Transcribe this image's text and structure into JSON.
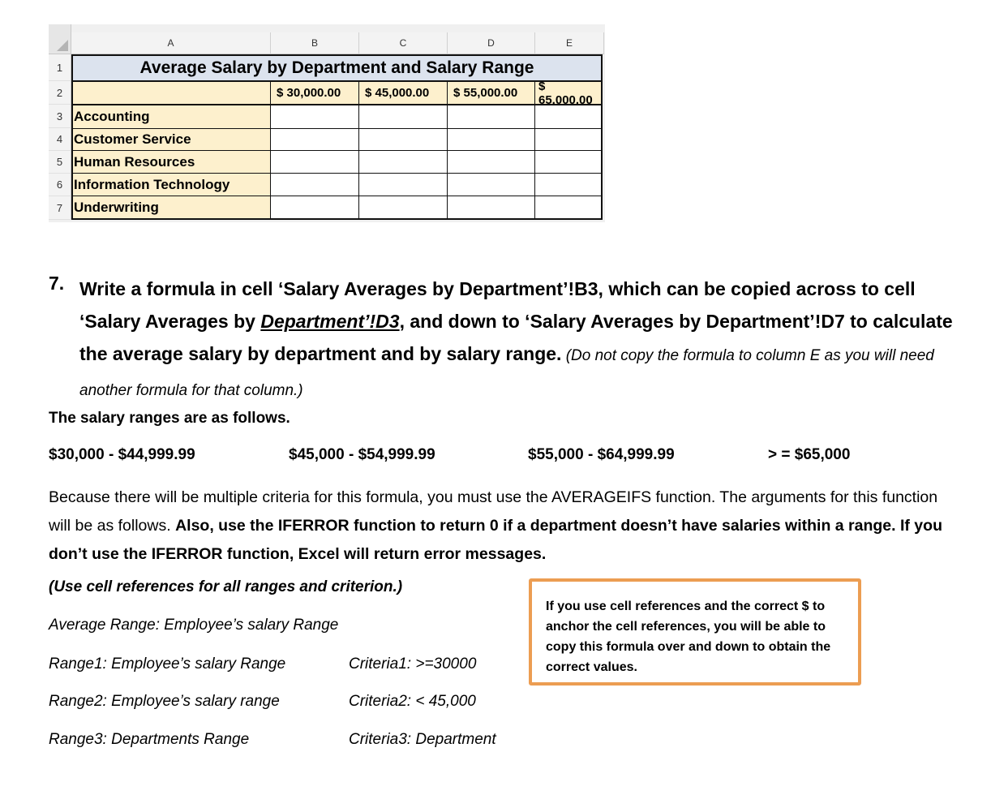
{
  "spreadsheet": {
    "column_headers": [
      "A",
      "B",
      "C",
      "D",
      "E"
    ],
    "row_headers": [
      "1",
      "2",
      "3",
      "4",
      "5",
      "6",
      "7"
    ],
    "title": "Average Salary by Department and Salary Range",
    "salary_thresholds": [
      "$ 30,000.00",
      "$ 45,000.00",
      "$ 55,000.00",
      "$ 65,000.00"
    ],
    "departments": [
      "Accounting",
      "Customer Service",
      "Human Resources",
      "Information Technology",
      "Underwriting"
    ]
  },
  "question": {
    "number": "7.",
    "part1": "Write a formula in cell ‘Salary Averages by Department’!B3, which can be copied across to cell ‘Salary Averages by ",
    "underlined": "Department’!D3",
    "part2": ", and down to ‘Salary Averages by Department’!D7 to calculate the average salary by department and by salary range.",
    "note": " (Do not copy the formula to column E as you will need another formula for that column.)"
  },
  "ranges_heading": "The salary ranges are as follows.",
  "salary_ranges": [
    "$30,000 - $44,999.99",
    "$45,000 - $54,999.99",
    "$55,000 - $64,999.99",
    "> = $65,000"
  ],
  "paragraph": {
    "normal1": "Because there will be multiple criteria for this formula, you must use the AVERAGEIFS function. The arguments for this function will be as follows. ",
    "bold1": "Also, use the IFERROR function to return 0 if a department doesn’t have salaries within a range.",
    "bold2": " If you don’t use the IFERROR function, Excel will return error messages."
  },
  "arguments": {
    "heading": "(Use cell references for all ranges and criterion.)",
    "average_range": "Average Range: Employee’s salary Range",
    "range1": "Range1: Employee’s salary Range",
    "criteria1": "Criteria1: >=30000",
    "range2": "Range2: Employee’s salary range",
    "criteria2": "Criteria2: < 45,000",
    "range3": "Range3: Departments Range",
    "criteria3": "Criteria3: Department"
  },
  "tip_box": {
    "text": "If you use cell references and the correct $ to anchor the cell references, you will be able to copy this formula over and down to obtain the correct values."
  }
}
